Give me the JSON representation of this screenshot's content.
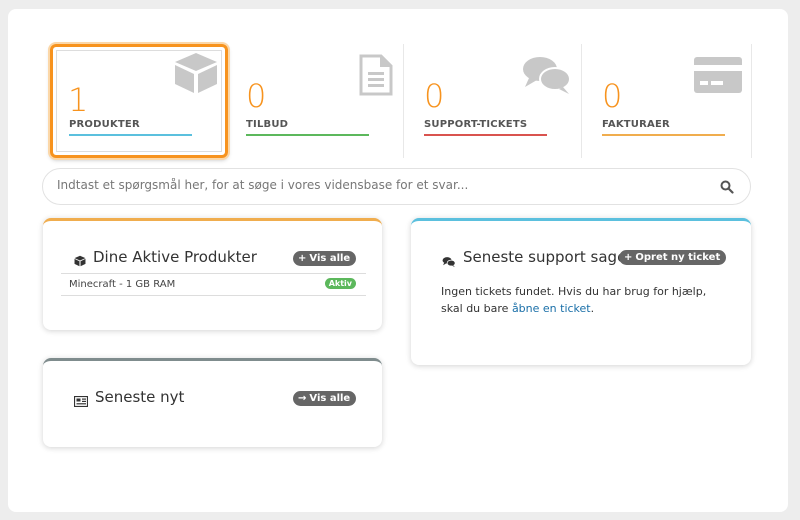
{
  "stats": [
    {
      "number": "1",
      "label": "PRODUKTER",
      "bar_color": "#5bc0de",
      "icon": "cube-icon"
    },
    {
      "number": "0",
      "label": "TILBUD",
      "bar_color": "#5cb85c",
      "icon": "document-icon"
    },
    {
      "number": "0",
      "label": "SUPPORT-TICKETS",
      "bar_color": "#d9534f",
      "icon": "comments-icon"
    },
    {
      "number": "0",
      "label": "FAKTURAER",
      "bar_color": "#f0ad4e",
      "icon": "credit-card-icon"
    }
  ],
  "search": {
    "placeholder": "Indtast et spørgsmål her, for at søge i vores vidensbase for et svar..."
  },
  "products_panel": {
    "title": "Dine Aktive Produkter",
    "button": "Vis alle",
    "accent": "#f0ad4e",
    "items": [
      {
        "name": "Minecraft - 1 GB RAM",
        "status": "Aktiv"
      }
    ]
  },
  "support_panel": {
    "title": "Seneste support sager",
    "button": "Opret ny ticket",
    "accent": "#5bc0de",
    "text_before": "Ingen tickets fundet. Hvis du har brug for hjælp, skal du bare",
    "link": "åbne en ticket",
    "text_after": "."
  },
  "news_panel": {
    "title": "Seneste nyt",
    "button": "Vis alle",
    "accent": "#7f8c8d"
  },
  "colors": {
    "accent_orange": "#f7931e",
    "icon_gray": "#c8c8c8"
  }
}
